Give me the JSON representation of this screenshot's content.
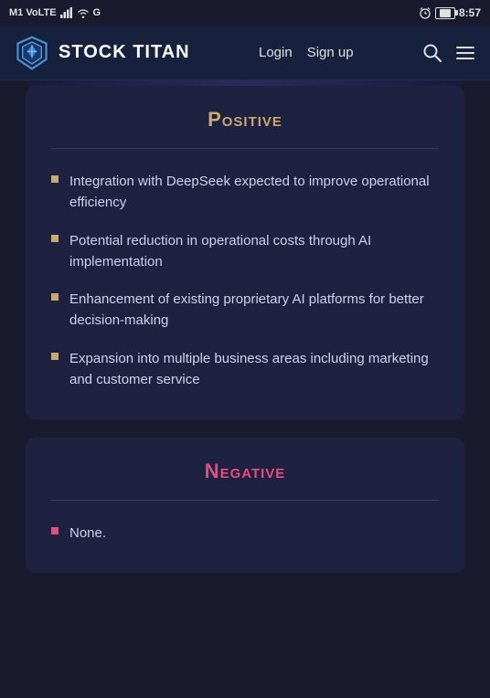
{
  "statusBar": {
    "left": "M1 VoLTE",
    "time": "8:57",
    "icons": [
      "signal",
      "wifi",
      "g-network",
      "alarm",
      "battery"
    ]
  },
  "navbar": {
    "logoText": "STOCK TITAN",
    "loginLabel": "Login",
    "signupLabel": "Sign up"
  },
  "sections": [
    {
      "id": "positive",
      "title": "Positive",
      "titleClass": "positive",
      "items": [
        "Integration with DeepSeek expected to improve operational efficiency",
        "Potential reduction in operational costs through AI implementation",
        "Enhancement of existing proprietary AI platforms for better decision-making",
        "Expansion into multiple business areas including marketing and customer service"
      ],
      "bulletClass": "positive-bullet"
    },
    {
      "id": "negative",
      "title": "Negative",
      "titleClass": "negative",
      "items": [
        "None."
      ],
      "bulletClass": "negative-bullet"
    }
  ]
}
